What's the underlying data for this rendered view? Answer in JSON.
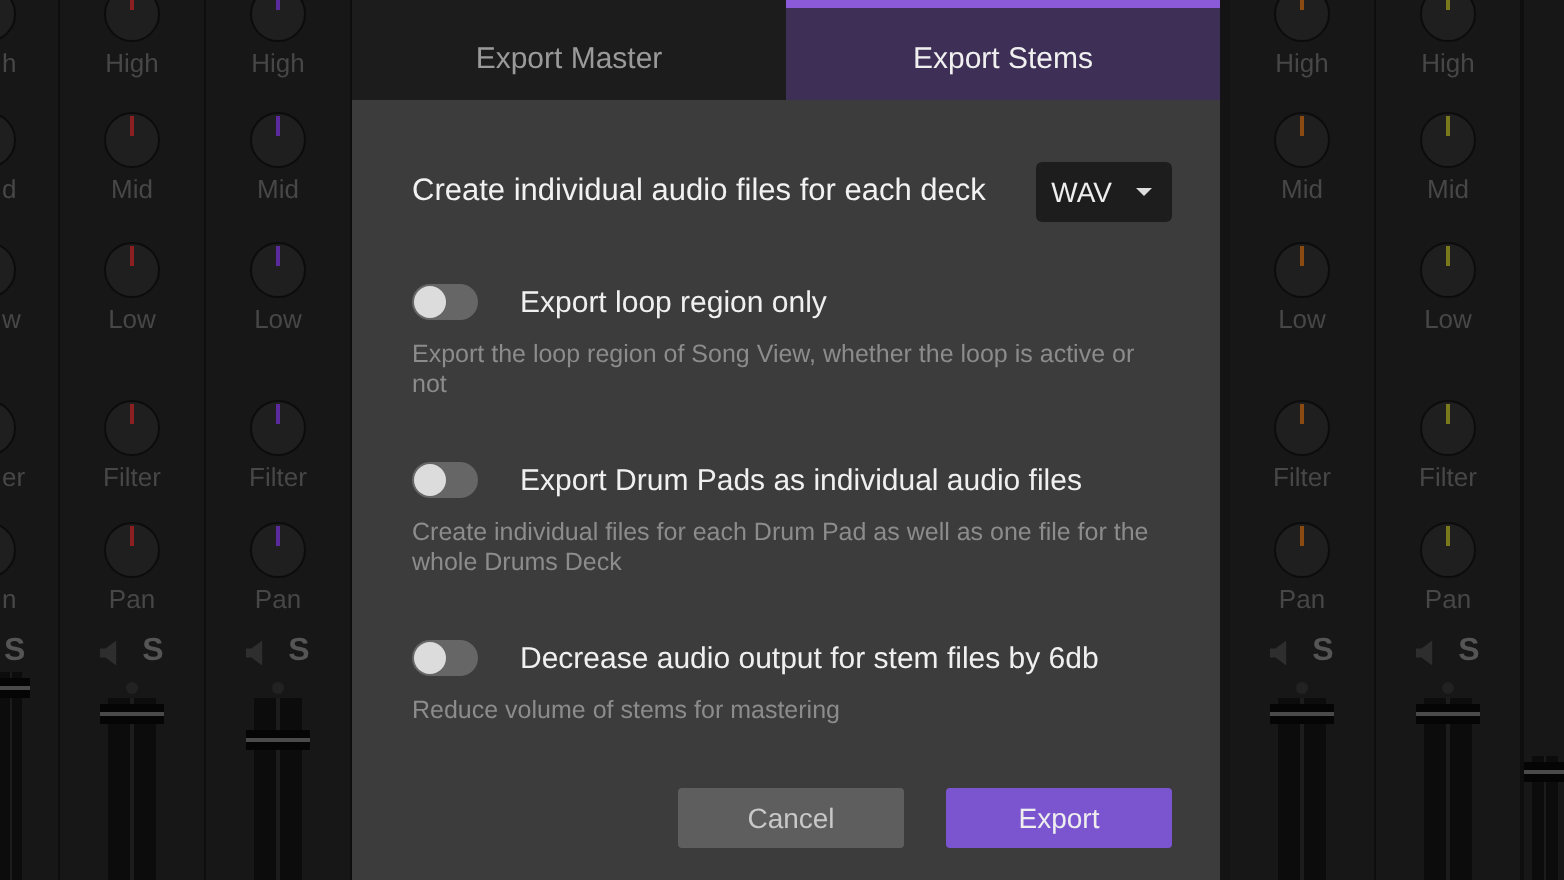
{
  "mixer_left": [
    {
      "kind": "partial",
      "labels": [
        "h",
        "d",
        "w",
        "er",
        "n"
      ],
      "solo": "S",
      "level": 0.96
    },
    {
      "kind": "full",
      "color": "#8c1f1f",
      "labels": [
        "High",
        "Mid",
        "Low",
        "Filter",
        "Pan"
      ],
      "solo": "S",
      "level": 0.96
    },
    {
      "kind": "full",
      "color": "#5b2a9c",
      "labels": [
        "High",
        "Mid",
        "Low",
        "Filter",
        "Pan"
      ],
      "solo": "S",
      "level": 0.79
    }
  ],
  "dialog": {
    "tabs": [
      {
        "label": "Export Master",
        "selected": false
      },
      {
        "label": "Export Stems",
        "selected": true
      }
    ],
    "format": {
      "label": "Create individual audio files for each deck",
      "value": "WAV"
    },
    "options": [
      {
        "label": "Export loop region only",
        "description": "Export the loop region of Song View, whether the loop is active or not",
        "on": false
      },
      {
        "label": "Export Drum Pads as individual audio files",
        "description": "Create individual files for each Drum Pad as well as one file for the whole Drums Deck",
        "on": false
      },
      {
        "label": "Decrease audio output for stem files by 6db",
        "description": "Reduce volume of stems for mastering",
        "on": false
      }
    ],
    "buttons": [
      {
        "label": "Cancel",
        "kind": "secondary"
      },
      {
        "label": "Export",
        "kind": "primary"
      }
    ]
  },
  "mixer_right": [
    {
      "kind": "full",
      "color": "#8a4a10",
      "labels": [
        "High",
        "Mid",
        "Low",
        "Filter",
        "Pan"
      ],
      "solo": "S",
      "level": 0.96
    },
    {
      "kind": "full",
      "color": "#7a7a1c",
      "labels": [
        "High",
        "Mid",
        "Low",
        "Filter",
        "Pan"
      ],
      "solo": "S",
      "level": 0.96
    },
    {
      "kind": "edge",
      "level": 0.96
    }
  ]
}
